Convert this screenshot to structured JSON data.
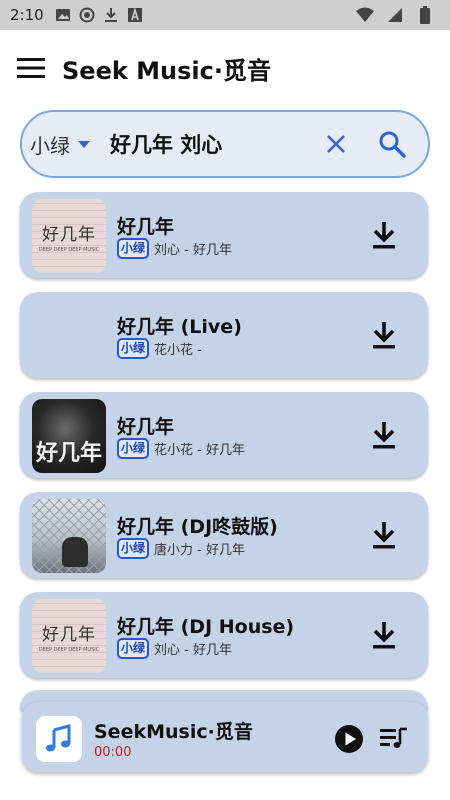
{
  "status_bar": {
    "time": "2:10"
  },
  "app_bar": {
    "title": "Seek Music·觅音"
  },
  "search": {
    "source": "小绿",
    "query": "好几年 刘心"
  },
  "results": [
    {
      "title": "好几年",
      "badge": "小绿",
      "meta": "刘心 - 好几年",
      "cover": "pink-wall-cover"
    },
    {
      "title": "好几年 (Live)",
      "badge": "小绿",
      "meta": "花小花 -",
      "cover": "none"
    },
    {
      "title": "好几年",
      "badge": "小绿",
      "meta": "花小花 - 好几年",
      "cover": "dark-portrait-cover"
    },
    {
      "title": "好几年 (DJ咚鼓版)",
      "badge": "小绿",
      "meta": "唐小力 - 好几年",
      "cover": "fence-photo-cover"
    },
    {
      "title": "好几年 (DJ House)",
      "badge": "小绿",
      "meta": "刘心 - 好几年",
      "cover": "pink-wall-cover"
    }
  ],
  "covers": {
    "pink_text": "好几年",
    "pink_sub": "DEEP DEEP DEEP MUSIC",
    "dark_text": "好几年"
  },
  "player": {
    "title": "SeekMusic·觅音",
    "time": "00:00"
  },
  "colors": {
    "accent": "#2b67c4",
    "card": "#c5d3e9",
    "search_bg": "#e6ebf5",
    "time_red": "#c0201a"
  }
}
